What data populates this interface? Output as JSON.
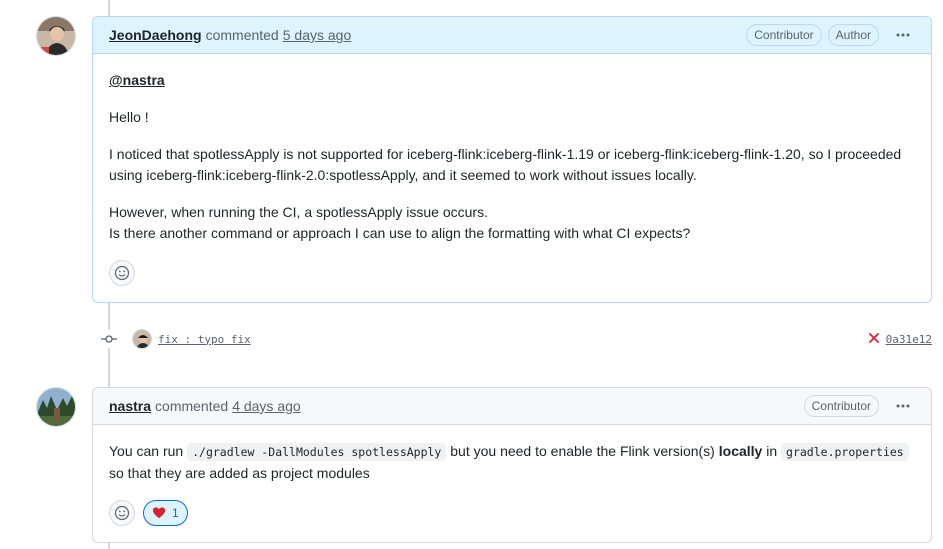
{
  "comments": [
    {
      "author": "JeonDaehong",
      "action": "commented",
      "time": "5 days ago",
      "badges": [
        "Contributor",
        "Author"
      ],
      "mention": "@nastra",
      "greeting": "Hello !",
      "para1": "I noticed that spotlessApply is not supported for iceberg-flink:iceberg-flink-1.19 or iceberg-flink:iceberg-flink-1.20, so I proceeded using iceberg-flink:iceberg-flink-2.0:spotlessApply, and it seemed to work without issues locally.",
      "para2_line1": "However, when running the CI, a spotlessApply issue occurs.",
      "para2_line2": "Is there another command or approach I can use to align the formatting with what CI expects?"
    },
    {
      "author": "nastra",
      "action": "commented",
      "time": "4 days ago",
      "badges": [
        "Contributor"
      ],
      "text_1": "You can run",
      "code_1": "./gradlew -DallModules spotlessApply",
      "text_2": "but you need to enable the Flink version(s)",
      "bold_1": "locally",
      "text_3": "in",
      "code_2": "gradle.properties",
      "text_4": "so that they are added as project modules",
      "reaction_count": "1"
    }
  ],
  "commit": {
    "message": "fix : typo fix",
    "sha": "0a31e12",
    "status": "failed"
  },
  "icons": {
    "kebab": "kebab-horizontal-icon",
    "emoji": "smiley-icon",
    "heart": "heart-icon",
    "commit": "git-commit-icon",
    "fail": "x-icon"
  }
}
